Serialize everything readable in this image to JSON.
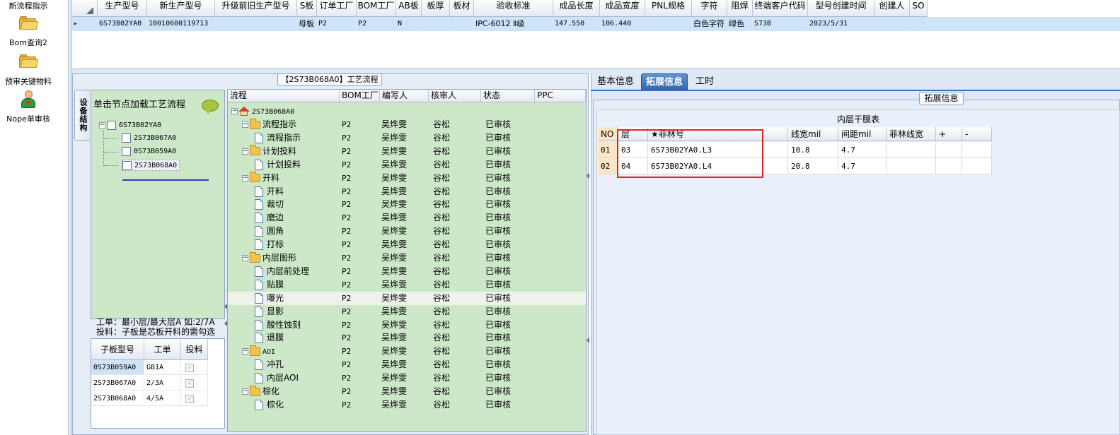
{
  "left_nav": {
    "items": [
      {
        "label": "新流程指示"
      },
      {
        "label": "Bom查询2"
      },
      {
        "label": "预审关键物料"
      },
      {
        "label": "Nope单审核"
      }
    ]
  },
  "top_grid": {
    "columns": [
      "生产型号",
      "新生产型号",
      "升级前旧生产型号",
      "S板",
      "订单工厂",
      "BOM工厂",
      "AB板",
      "板厚",
      "板材",
      "验收标准",
      "成品长度",
      "成品宽度",
      "PNL规格",
      "字符",
      "阻焊",
      "终端客户代码",
      "型号创建时间",
      "创建人",
      "SO"
    ],
    "row": [
      "6S73B02YA0",
      "10010600119713",
      "",
      "母板",
      "P2",
      "P2",
      "N",
      "",
      "",
      "IPC-6012 Ⅱ级",
      "147.550",
      "106.440",
      "",
      "白色字符",
      "绿色",
      "S73B",
      "2023/5/31",
      "",
      ""
    ],
    "row_marker": "▸"
  },
  "process_panel": {
    "title": "【2S73B068A0】工艺流程",
    "vertical_tab": "设备结构",
    "tree_hint": "单击节点加载工艺流程",
    "tree": {
      "root": "6S73B02YA0",
      "children": [
        "2S73B067A0",
        "0S73B059A0",
        "2S73B068A0"
      ]
    },
    "info_line1": "工单：最小层/最大层A 如:2/7A",
    "info_line2": "投料：子板是芯板开料的需勾选",
    "sub_grid": {
      "columns": [
        "子板型号",
        "工单",
        "投料"
      ],
      "rows": [
        {
          "model": "0S73B059A0",
          "order": "GB1A",
          "feed": "✓"
        },
        {
          "model": "2S73B067A0",
          "order": "2/3A",
          "feed": "✓"
        },
        {
          "model": "2S73B068A0",
          "order": "4/5A",
          "feed": "✓"
        }
      ]
    }
  },
  "process_grid": {
    "columns": [
      "流程",
      "BOM工厂",
      "编写人",
      "核审人",
      "状态",
      "PPC"
    ],
    "root": "2S73B068A0",
    "rows": [
      {
        "name": "流程指示",
        "level": 1,
        "type": "folder",
        "bom": "P2",
        "writer": "吴烨雯",
        "reviewer": "谷松",
        "status": "已审核"
      },
      {
        "name": "流程指示",
        "level": 2,
        "type": "doc",
        "bom": "P2",
        "writer": "吴烨雯",
        "reviewer": "谷松",
        "status": "已审核"
      },
      {
        "name": "计划投料",
        "level": 1,
        "type": "folder",
        "bom": "P2",
        "writer": "吴烨雯",
        "reviewer": "谷松",
        "status": "已审核"
      },
      {
        "name": "计划投料",
        "level": 2,
        "type": "doc",
        "bom": "P2",
        "writer": "吴烨雯",
        "reviewer": "谷松",
        "status": "已审核"
      },
      {
        "name": "开料",
        "level": 1,
        "type": "folder",
        "bom": "P2",
        "writer": "吴烨雯",
        "reviewer": "谷松",
        "status": "已审核"
      },
      {
        "name": "开料",
        "level": 2,
        "type": "doc",
        "bom": "P2",
        "writer": "吴烨雯",
        "reviewer": "谷松",
        "status": "已审核"
      },
      {
        "name": "裁切",
        "level": 2,
        "type": "doc",
        "bom": "P2",
        "writer": "吴烨雯",
        "reviewer": "谷松",
        "status": "已审核"
      },
      {
        "name": "磨边",
        "level": 2,
        "type": "doc",
        "bom": "P2",
        "writer": "吴烨雯",
        "reviewer": "谷松",
        "status": "已审核"
      },
      {
        "name": "圆角",
        "level": 2,
        "type": "doc",
        "bom": "P2",
        "writer": "吴烨雯",
        "reviewer": "谷松",
        "status": "已审核"
      },
      {
        "name": "打标",
        "level": 2,
        "type": "doc",
        "bom": "P2",
        "writer": "吴烨雯",
        "reviewer": "谷松",
        "status": "已审核"
      },
      {
        "name": "内层图形",
        "level": 1,
        "type": "folder",
        "bom": "P2",
        "writer": "吴烨雯",
        "reviewer": "谷松",
        "status": "已审核"
      },
      {
        "name": "内层前处理",
        "level": 2,
        "type": "doc",
        "bom": "P2",
        "writer": "吴烨雯",
        "reviewer": "谷松",
        "status": "已审核"
      },
      {
        "name": "贴膜",
        "level": 2,
        "type": "doc",
        "bom": "P2",
        "writer": "吴烨雯",
        "reviewer": "谷松",
        "status": "已审核"
      },
      {
        "name": "曝光",
        "level": 2,
        "type": "doc",
        "bom": "P2",
        "writer": "吴烨雯",
        "reviewer": "谷松",
        "status": "已审核",
        "selected": true
      },
      {
        "name": "显影",
        "level": 2,
        "type": "doc",
        "bom": "P2",
        "writer": "吴烨雯",
        "reviewer": "谷松",
        "status": "已审核"
      },
      {
        "name": "酸性蚀刻",
        "level": 2,
        "type": "doc",
        "bom": "P2",
        "writer": "吴烨雯",
        "reviewer": "谷松",
        "status": "已审核"
      },
      {
        "name": "退膜",
        "level": 2,
        "type": "doc",
        "bom": "P2",
        "writer": "吴烨雯",
        "reviewer": "谷松",
        "status": "已审核"
      },
      {
        "name": "AOI",
        "level": 1,
        "type": "folder",
        "bom": "P2",
        "writer": "吴烨雯",
        "reviewer": "谷松",
        "status": "已审核"
      },
      {
        "name": "冲孔",
        "level": 2,
        "type": "doc",
        "bom": "P2",
        "writer": "吴烨雯",
        "reviewer": "谷松",
        "status": "已审核"
      },
      {
        "name": "内层AOI",
        "level": 2,
        "type": "doc",
        "bom": "P2",
        "writer": "吴烨雯",
        "reviewer": "谷松",
        "status": "已审核"
      },
      {
        "name": "棕化",
        "level": 1,
        "type": "folder",
        "bom": "P2",
        "writer": "吴烨雯",
        "reviewer": "谷松",
        "status": "已审核"
      },
      {
        "name": "棕化",
        "level": 2,
        "type": "doc",
        "bom": "P2",
        "writer": "吴烨雯",
        "reviewer": "谷松",
        "status": "已审核"
      }
    ]
  },
  "right_panel": {
    "tabs": [
      "基本信息",
      "拓展信息",
      "工时"
    ],
    "active_tab": "拓展信息",
    "section_title": "拓展信息",
    "table_title": "内层干膜表",
    "columns": [
      "NO",
      "层",
      "★菲林号",
      "线宽mil",
      "间距mil",
      "菲林线宽",
      "+",
      "-"
    ],
    "rows": [
      [
        "01",
        "03",
        "6S73B02YA0.L3",
        "10.8",
        "4.7",
        "",
        "",
        ""
      ],
      [
        "02",
        "04",
        "6S73B02YA0.L4",
        "20.8",
        "4.7",
        "",
        "",
        ""
      ]
    ]
  },
  "colors": {
    "tree_bg": "#cce8c8",
    "selected_row": "#cde3f8",
    "active_tab": "#2f66b0",
    "highlight_box": "#e02424"
  }
}
